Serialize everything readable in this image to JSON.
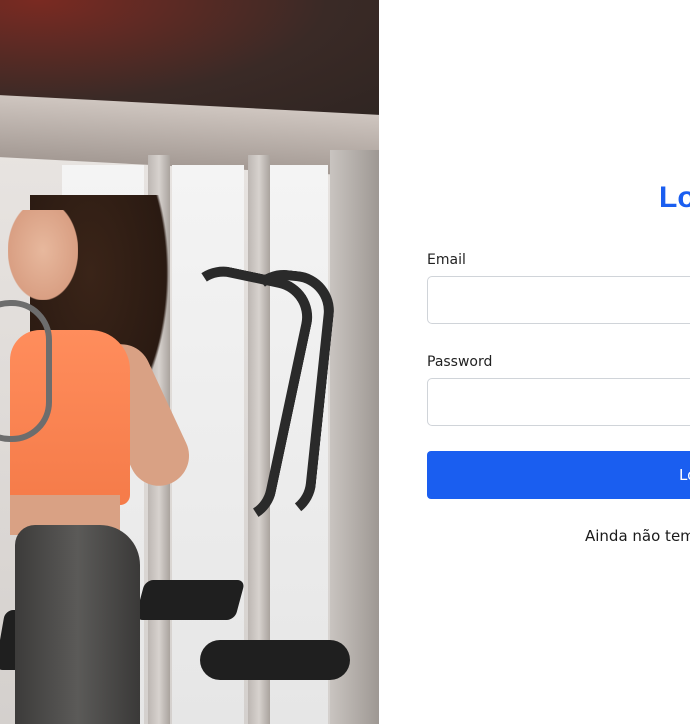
{
  "login": {
    "title": "Lo",
    "email_label": "Email",
    "email_value": "",
    "password_label": "Password",
    "password_value": "",
    "submit_label": "Lo",
    "signup_prompt": "Ainda não tem"
  },
  "colors": {
    "accent": "#1a5ef0",
    "input_border": "#d0d4d9",
    "background": "#ffffff"
  },
  "image": {
    "alt_icon": "gym-photo"
  }
}
